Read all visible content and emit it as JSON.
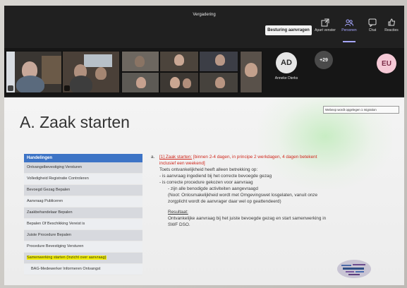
{
  "window": {
    "title": "Vergadering"
  },
  "toolbar": {
    "control_request_label": "Besturing aanvragen",
    "actions": [
      {
        "label": "Apart venster",
        "icon": "popout-icon"
      },
      {
        "label": "Personen",
        "icon": "people-icon",
        "active": true
      },
      {
        "label": "Chat",
        "icon": "chat-icon"
      },
      {
        "label": "Reacties",
        "icon": "reactions-icon"
      }
    ]
  },
  "participants": {
    "featured": {
      "initials": "AD",
      "name": "Anneke Dierks"
    },
    "overflow_count": "+29",
    "self": {
      "initials": "EU"
    }
  },
  "slide": {
    "title": "A. Zaak starten",
    "table_header": "Handelingen",
    "items": [
      "Ontvangstbevestiging Versturen",
      "Volledigheid Registratie Controleren",
      "Bevoegd Gezag Bepalen",
      "Aanvraag Publiceren",
      "Zaakbehandelaar Bepalen",
      "Bepalen Of Beschikking Vereist is",
      "Juiste Procedure Bepalen",
      "Procedure Bevestiging Versturen",
      "Samenwerking starten (Inzicht over aanvraag)",
      "BAG-Medewerker Informeren Ontvangst"
    ],
    "highlighted_index": 8,
    "content": {
      "bullet": "a.",
      "heading_link": "[1] Zaak starten:",
      "heading_red": "[binnen 2-4 dagen, in principe 2 werkdagen, 4 dagen betekent",
      "heading_red2": "inclusief een weekend]",
      "lines": [
        "Toets ontvankelijkheid heeft alleen betrekking op:",
        "- is aanvraag ingediend bij het correcte bevoegde gezag",
        "- is correcte procedure gekozen voor aanvraag",
        "- zijn alle benodigde activiteiten aangevraagd",
        "(Noot: Onlosmakelijkheid wordt met Omgevingswet losgelaten, vanuit onze",
        "zorgplicht wordt de aanvrager daar wel op geattendeerd)"
      ],
      "result_label": "Resultaat:",
      "result_lines": [
        "Ontvankelijke aanvraag bij het juiste bevoegde gezag en start samenwerking in",
        "SWF DSO."
      ]
    },
    "tooltip": "Webexp wordt opgelegen 1 migration"
  },
  "colors": {
    "table_header": "#3d74c6",
    "highlight": "#f4f000",
    "accent_red": "#d0281d",
    "teams_accent": "#a6a7ff"
  }
}
